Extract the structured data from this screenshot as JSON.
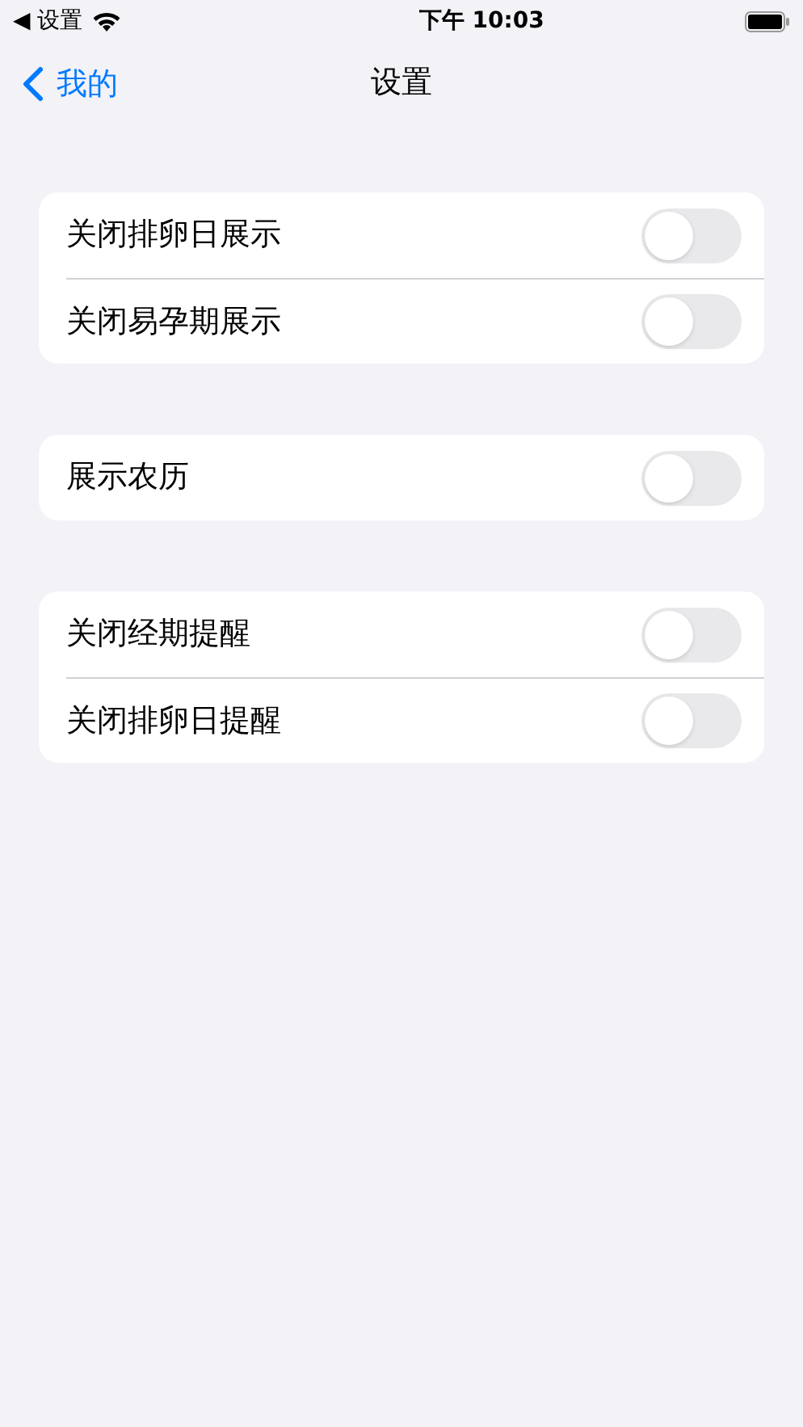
{
  "status_bar": {
    "back_app": "◀ 设置",
    "time": "下午 10:03"
  },
  "nav": {
    "back": "我的",
    "title": "设置"
  },
  "groups": [
    {
      "rows": [
        {
          "label": "关闭排卵日展示",
          "on": false
        },
        {
          "label": "关闭易孕期展示",
          "on": false
        }
      ]
    },
    {
      "rows": [
        {
          "label": "展示农历",
          "on": false
        }
      ]
    },
    {
      "rows": [
        {
          "label": "关闭经期提醒",
          "on": false
        },
        {
          "label": "关闭排卵日提醒",
          "on": false
        }
      ]
    }
  ]
}
